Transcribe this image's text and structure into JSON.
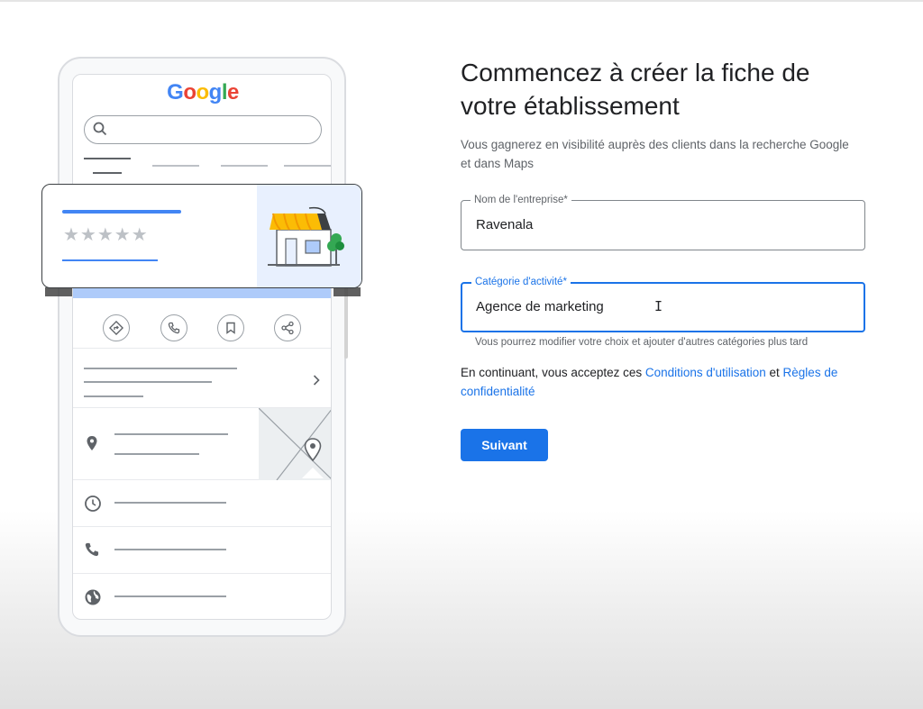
{
  "illustration": {
    "logo_letters": [
      {
        "ch": "G",
        "color": "#4285f4"
      },
      {
        "ch": "o",
        "color": "#ea4335"
      },
      {
        "ch": "o",
        "color": "#fbbc05"
      },
      {
        "ch": "g",
        "color": "#4285f4"
      },
      {
        "ch": "l",
        "color": "#34a853"
      },
      {
        "ch": "e",
        "color": "#ea4335"
      }
    ],
    "stars": "★★★★★",
    "icons": [
      "search-icon",
      "directions-icon",
      "phone-icon",
      "bookmark-icon",
      "share-icon",
      "chevron-right-icon",
      "location-pin-icon",
      "clock-icon",
      "phone-icon",
      "globe-icon",
      "storefront-icon"
    ]
  },
  "form": {
    "title": "Commencez à créer la fiche de votre établissement",
    "subtitle": "Vous gagnerez en visibilité auprès des clients dans la recherche Google et dans Maps",
    "business_name": {
      "label": "Nom de l'entreprise*",
      "value": "Ravenala"
    },
    "category": {
      "label": "Catégorie d'activité*",
      "value": "Agence de marketing",
      "helper": "Vous pourrez modifier votre choix et ajouter d'autres catégories plus tard"
    },
    "terms": {
      "prefix": "En continuant, vous acceptez ces ",
      "terms_link": "Conditions d'utilisation",
      "middle": " et ",
      "privacy_link": "Règles de confidentialité"
    },
    "next_button": "Suivant"
  },
  "colors": {
    "accent": "#1a73e8",
    "google_blue": "#4285f4",
    "awning_yellow": "#fbbc05"
  }
}
